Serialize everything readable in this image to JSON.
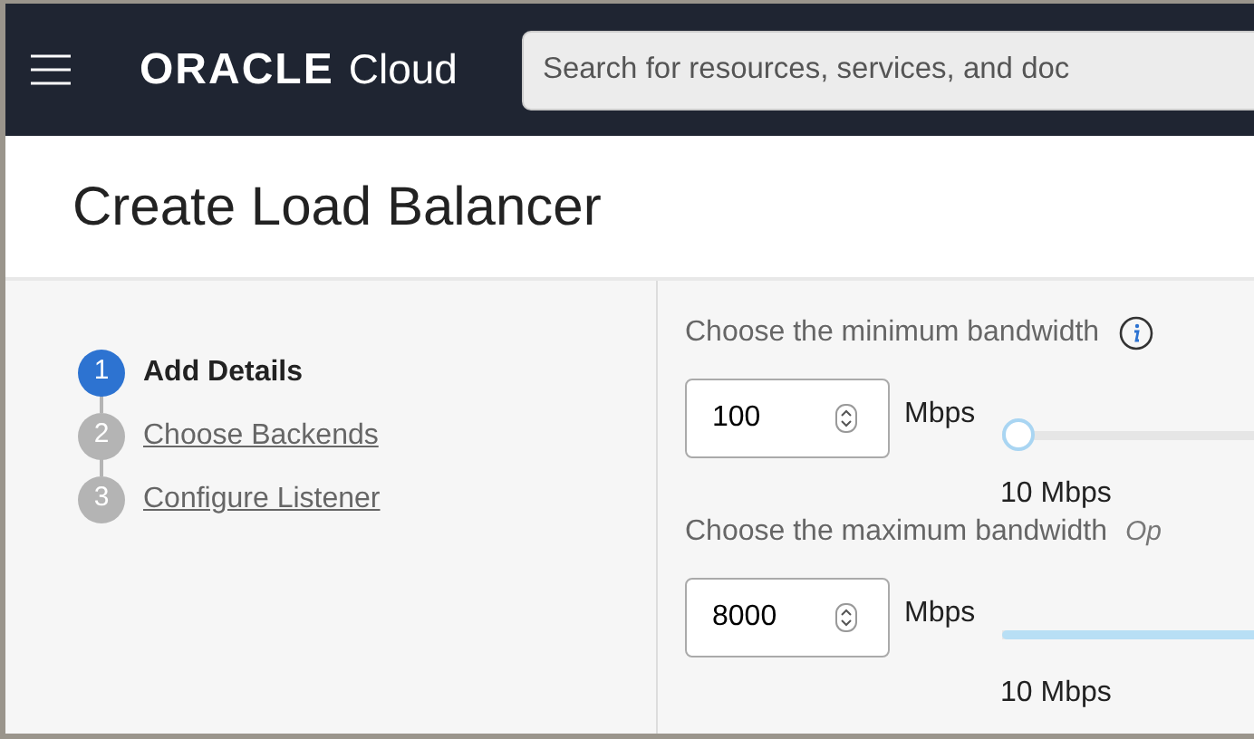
{
  "header": {
    "logo_word": "ORACLE",
    "logo_suffix": "Cloud",
    "search": {
      "placeholder": "Search for resources, services, and doc"
    }
  },
  "page_title": "Create Load Balancer",
  "steps": [
    {
      "number": "1",
      "label": "Add Details",
      "selected": true
    },
    {
      "number": "2",
      "label": "Choose Backends",
      "selected": false
    },
    {
      "number": "3",
      "label": "Configure Listener",
      "selected": false
    }
  ],
  "bandwidth": [
    {
      "label": "Choose the minimum bandwidth",
      "note": {
        "kind": "info"
      },
      "value": "100",
      "unit": "Mbps",
      "level": 0,
      "reading": "10 Mbps"
    },
    {
      "label": "Choose the maximum bandwidth",
      "note": {
        "kind": "text",
        "text": "Op"
      },
      "value": "8000",
      "unit": "Mbps",
      "level": 1,
      "reading": "10 Mbps"
    }
  ]
}
